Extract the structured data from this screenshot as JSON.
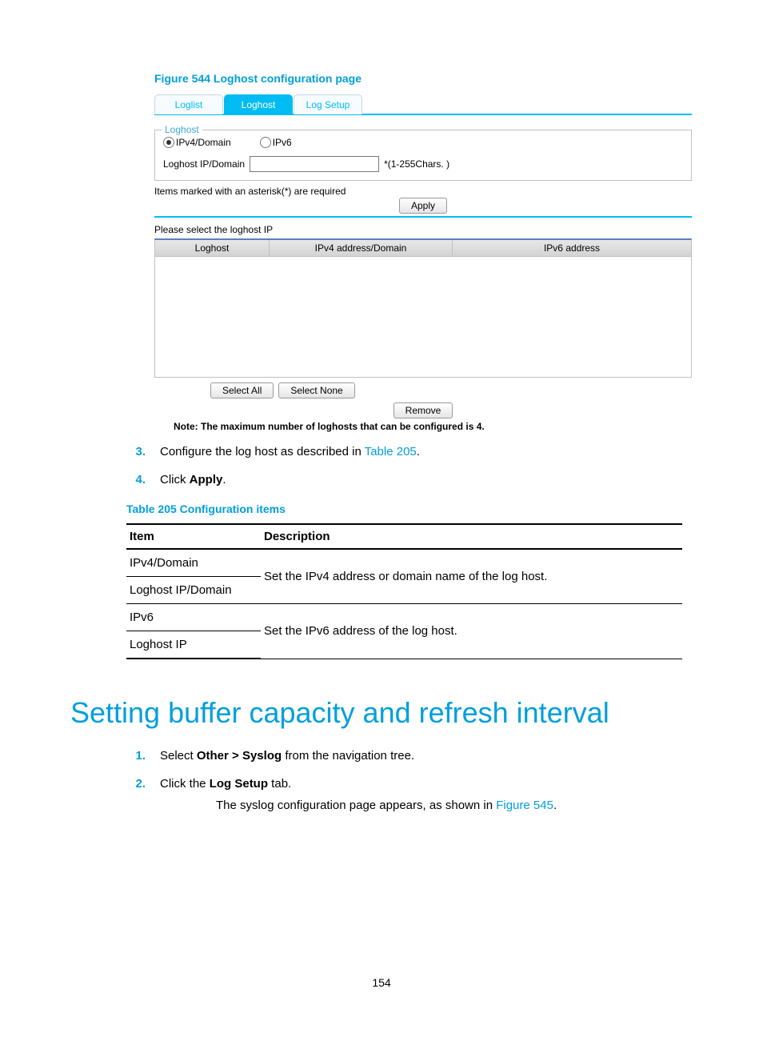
{
  "figure": {
    "caption": "Figure 544 Loghost configuration page",
    "tabs": {
      "loglist": "Loglist",
      "loghost": "Loghost",
      "logsetup": "Log Setup"
    },
    "legend": "Loghost",
    "radios": {
      "ipv4": "IPv4/Domain",
      "ipv6": "IPv6"
    },
    "ip_label": "Loghost IP/Domain",
    "hint": "*(1-255Chars. )",
    "req_note": "Items marked with an asterisk(*) are required",
    "apply_btn": "Apply",
    "select_prompt": "Please select the loghost IP",
    "cols": {
      "c1": "Loghost",
      "c2": "IPv4 address/Domain",
      "c3": "IPv6 address"
    },
    "select_all": "Select All",
    "select_none": "Select None",
    "remove": "Remove",
    "max_note": "Note: The maximum number of loghosts that can be configured is 4."
  },
  "steps_a": {
    "n3": "3.",
    "t3_pre": "Configure the log host as described in ",
    "t3_link": "Table 205",
    "t3_post": ".",
    "n4": "4.",
    "t4_pre": "Click ",
    "t4_bold": "Apply",
    "t4_post": "."
  },
  "table": {
    "caption": "Table 205 Configuration items",
    "head_item": "Item",
    "head_desc": "Description",
    "r1_item": "IPv4/Domain",
    "r2_item": "Loghost IP/Domain",
    "desc1": "Set the IPv4 address or domain name of the log host.",
    "r3_item": "IPv6",
    "r4_item": "Loghost IP",
    "desc2": "Set the IPv6 address of the log host."
  },
  "heading": "Setting buffer capacity and refresh interval",
  "steps_b": {
    "n1": "1.",
    "t1_pre": "Select ",
    "t1_bold": "Other > Syslog",
    "t1_post": " from the navigation tree.",
    "n2": "2.",
    "t2_pre": "Click the ",
    "t2_bold": "Log Setup",
    "t2_post": " tab.",
    "t2_line2_pre": "The syslog configuration page appears, as shown in ",
    "t2_line2_link": "Figure 545",
    "t2_line2_post": "."
  },
  "page_number": "154"
}
